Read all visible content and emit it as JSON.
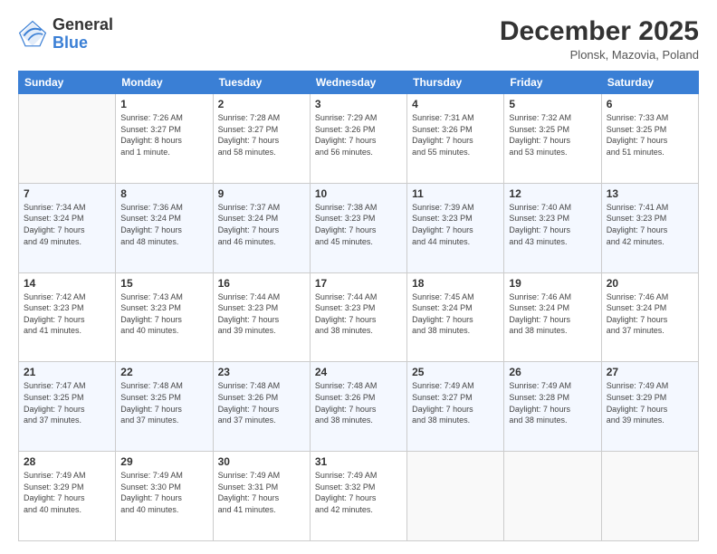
{
  "logo": {
    "general": "General",
    "blue": "Blue"
  },
  "header": {
    "month": "December 2025",
    "location": "Plonsk, Mazovia, Poland"
  },
  "weekdays": [
    "Sunday",
    "Monday",
    "Tuesday",
    "Wednesday",
    "Thursday",
    "Friday",
    "Saturday"
  ],
  "weeks": [
    [
      {
        "day": "",
        "info": ""
      },
      {
        "day": "1",
        "info": "Sunrise: 7:26 AM\nSunset: 3:27 PM\nDaylight: 8 hours\nand 1 minute."
      },
      {
        "day": "2",
        "info": "Sunrise: 7:28 AM\nSunset: 3:27 PM\nDaylight: 7 hours\nand 58 minutes."
      },
      {
        "day": "3",
        "info": "Sunrise: 7:29 AM\nSunset: 3:26 PM\nDaylight: 7 hours\nand 56 minutes."
      },
      {
        "day": "4",
        "info": "Sunrise: 7:31 AM\nSunset: 3:26 PM\nDaylight: 7 hours\nand 55 minutes."
      },
      {
        "day": "5",
        "info": "Sunrise: 7:32 AM\nSunset: 3:25 PM\nDaylight: 7 hours\nand 53 minutes."
      },
      {
        "day": "6",
        "info": "Sunrise: 7:33 AM\nSunset: 3:25 PM\nDaylight: 7 hours\nand 51 minutes."
      }
    ],
    [
      {
        "day": "7",
        "info": "Sunrise: 7:34 AM\nSunset: 3:24 PM\nDaylight: 7 hours\nand 49 minutes."
      },
      {
        "day": "8",
        "info": "Sunrise: 7:36 AM\nSunset: 3:24 PM\nDaylight: 7 hours\nand 48 minutes."
      },
      {
        "day": "9",
        "info": "Sunrise: 7:37 AM\nSunset: 3:24 PM\nDaylight: 7 hours\nand 46 minutes."
      },
      {
        "day": "10",
        "info": "Sunrise: 7:38 AM\nSunset: 3:23 PM\nDaylight: 7 hours\nand 45 minutes."
      },
      {
        "day": "11",
        "info": "Sunrise: 7:39 AM\nSunset: 3:23 PM\nDaylight: 7 hours\nand 44 minutes."
      },
      {
        "day": "12",
        "info": "Sunrise: 7:40 AM\nSunset: 3:23 PM\nDaylight: 7 hours\nand 43 minutes."
      },
      {
        "day": "13",
        "info": "Sunrise: 7:41 AM\nSunset: 3:23 PM\nDaylight: 7 hours\nand 42 minutes."
      }
    ],
    [
      {
        "day": "14",
        "info": "Sunrise: 7:42 AM\nSunset: 3:23 PM\nDaylight: 7 hours\nand 41 minutes."
      },
      {
        "day": "15",
        "info": "Sunrise: 7:43 AM\nSunset: 3:23 PM\nDaylight: 7 hours\nand 40 minutes."
      },
      {
        "day": "16",
        "info": "Sunrise: 7:44 AM\nSunset: 3:23 PM\nDaylight: 7 hours\nand 39 minutes."
      },
      {
        "day": "17",
        "info": "Sunrise: 7:44 AM\nSunset: 3:23 PM\nDaylight: 7 hours\nand 38 minutes."
      },
      {
        "day": "18",
        "info": "Sunrise: 7:45 AM\nSunset: 3:24 PM\nDaylight: 7 hours\nand 38 minutes."
      },
      {
        "day": "19",
        "info": "Sunrise: 7:46 AM\nSunset: 3:24 PM\nDaylight: 7 hours\nand 38 minutes."
      },
      {
        "day": "20",
        "info": "Sunrise: 7:46 AM\nSunset: 3:24 PM\nDaylight: 7 hours\nand 37 minutes."
      }
    ],
    [
      {
        "day": "21",
        "info": "Sunrise: 7:47 AM\nSunset: 3:25 PM\nDaylight: 7 hours\nand 37 minutes."
      },
      {
        "day": "22",
        "info": "Sunrise: 7:48 AM\nSunset: 3:25 PM\nDaylight: 7 hours\nand 37 minutes."
      },
      {
        "day": "23",
        "info": "Sunrise: 7:48 AM\nSunset: 3:26 PM\nDaylight: 7 hours\nand 37 minutes."
      },
      {
        "day": "24",
        "info": "Sunrise: 7:48 AM\nSunset: 3:26 PM\nDaylight: 7 hours\nand 38 minutes."
      },
      {
        "day": "25",
        "info": "Sunrise: 7:49 AM\nSunset: 3:27 PM\nDaylight: 7 hours\nand 38 minutes."
      },
      {
        "day": "26",
        "info": "Sunrise: 7:49 AM\nSunset: 3:28 PM\nDaylight: 7 hours\nand 38 minutes."
      },
      {
        "day": "27",
        "info": "Sunrise: 7:49 AM\nSunset: 3:29 PM\nDaylight: 7 hours\nand 39 minutes."
      }
    ],
    [
      {
        "day": "28",
        "info": "Sunrise: 7:49 AM\nSunset: 3:29 PM\nDaylight: 7 hours\nand 40 minutes."
      },
      {
        "day": "29",
        "info": "Sunrise: 7:49 AM\nSunset: 3:30 PM\nDaylight: 7 hours\nand 40 minutes."
      },
      {
        "day": "30",
        "info": "Sunrise: 7:49 AM\nSunset: 3:31 PM\nDaylight: 7 hours\nand 41 minutes."
      },
      {
        "day": "31",
        "info": "Sunrise: 7:49 AM\nSunset: 3:32 PM\nDaylight: 7 hours\nand 42 minutes."
      },
      {
        "day": "",
        "info": ""
      },
      {
        "day": "",
        "info": ""
      },
      {
        "day": "",
        "info": ""
      }
    ]
  ]
}
